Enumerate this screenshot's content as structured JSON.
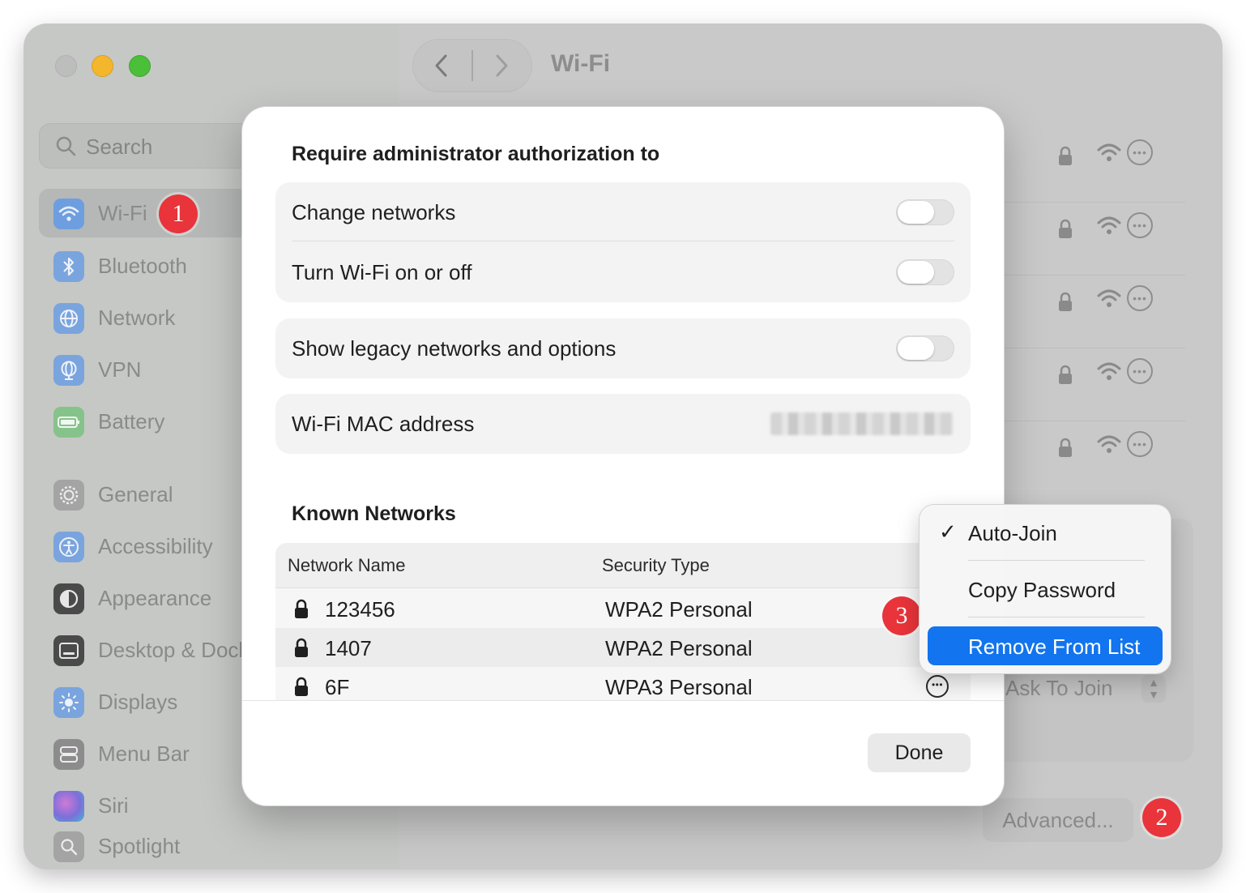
{
  "sidebar": {
    "search_placeholder": "Search",
    "items": [
      {
        "label": "Wi-Fi",
        "icon": "wifi-icon",
        "color": "#3d86e8"
      },
      {
        "label": "Bluetooth",
        "icon": "bluetooth-icon",
        "color": "#3d86e8"
      },
      {
        "label": "Network",
        "icon": "globe-icon",
        "color": "#3d86e8"
      },
      {
        "label": "VPN",
        "icon": "vpn-globe-icon",
        "color": "#3d86e8"
      },
      {
        "label": "Battery",
        "icon": "battery-icon",
        "color": "#53b65a"
      },
      {
        "label": "General",
        "icon": "gear-icon",
        "color": "#8e8e8e"
      },
      {
        "label": "Accessibility",
        "icon": "accessibility-icon",
        "color": "#3d86e8"
      },
      {
        "label": "Appearance",
        "icon": "appearance-icon",
        "color": "#2b2b2b"
      },
      {
        "label": "Desktop & Dock",
        "icon": "dock-icon",
        "color": "#2b2b2b"
      },
      {
        "label": "Displays",
        "icon": "sun-icon",
        "color": "#3d86e8"
      },
      {
        "label": "Menu Bar",
        "icon": "menu-bar-icon",
        "color": "#6e6e6e"
      },
      {
        "label": "Siri",
        "icon": "siri-icon",
        "color": "#9a4fd0"
      },
      {
        "label": "Spotlight",
        "icon": "magnifier-icon",
        "color": "#8e8e8e"
      }
    ]
  },
  "window": {
    "title": "Wi-Fi"
  },
  "background": {
    "ask_to_join": "Ask To Join",
    "advanced_label": "Advanced..."
  },
  "badges": {
    "one": "1",
    "two": "2",
    "three": "3"
  },
  "modal": {
    "auth_heading": "Require administrator authorization to",
    "change_networks": "Change networks",
    "turn_wifi": "Turn Wi-Fi on or off",
    "show_legacy": "Show legacy networks and options",
    "mac_label": "Wi-Fi MAC address",
    "known_heading": "Known Networks",
    "columns": {
      "name": "Network Name",
      "security": "Security Type"
    },
    "networks": [
      {
        "name": "123456",
        "security": "WPA2 Personal"
      },
      {
        "name": "1407",
        "security": "WPA2 Personal"
      },
      {
        "name": "6F",
        "security": "WPA3 Personal"
      }
    ],
    "done_label": "Done"
  },
  "context_menu": {
    "auto_join": "Auto-Join",
    "auto_join_check": "✓",
    "copy_password": "Copy Password",
    "remove": "Remove From List"
  },
  "colors": {
    "accent": "#1274ee",
    "badge": "#e8343a"
  }
}
